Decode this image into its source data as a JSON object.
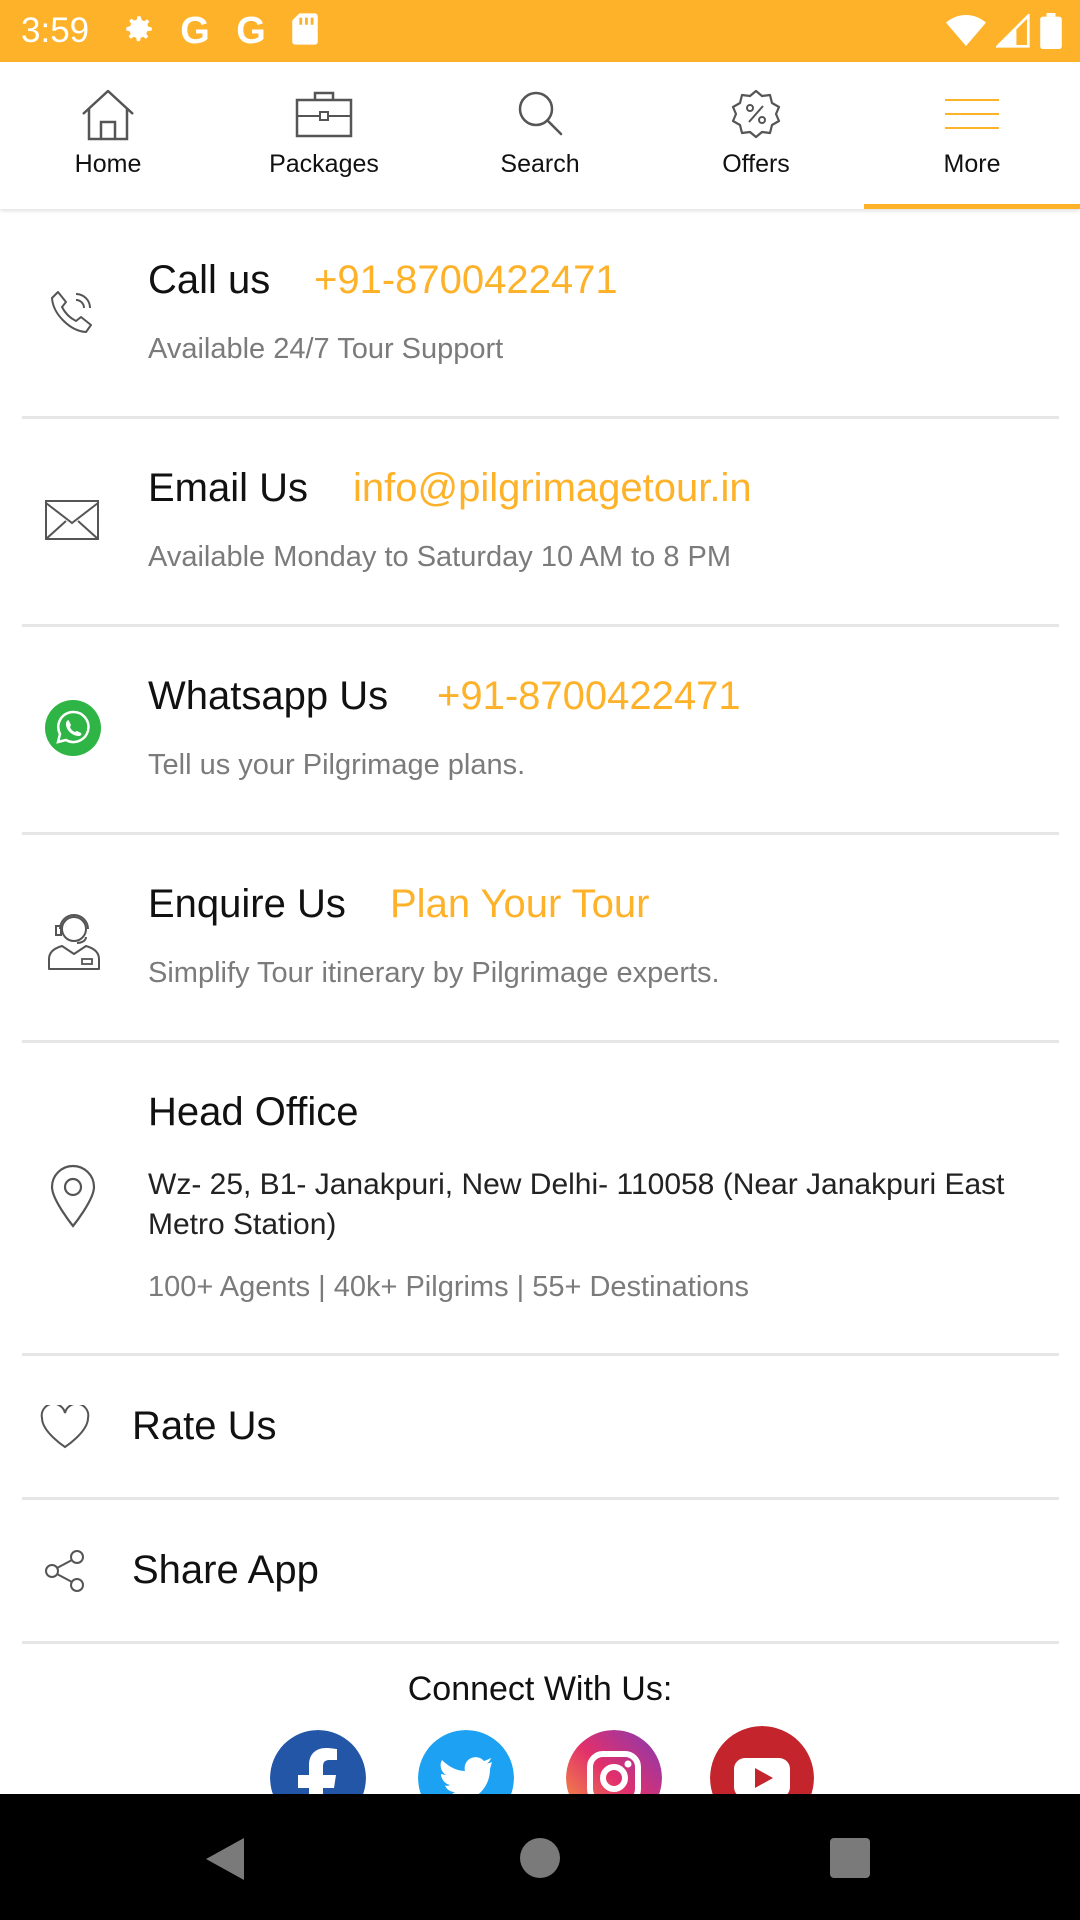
{
  "status_bar": {
    "time": "3:59",
    "color": "#FDB22A",
    "left_icons": [
      "gear-icon",
      "google-g-icon",
      "google-g-icon",
      "sd-card-icon"
    ],
    "right_icons": [
      "wifi-icon",
      "signal-icon",
      "battery-icon"
    ],
    "g_letter": "G"
  },
  "nav": {
    "tabs": [
      {
        "label": "Home",
        "icon": "home-icon"
      },
      {
        "label": "Packages",
        "icon": "briefcase-icon"
      },
      {
        "label": "Search",
        "icon": "search-icon"
      },
      {
        "label": "Offers",
        "icon": "offers-badge-icon"
      },
      {
        "label": "More",
        "icon": "menu-icon"
      }
    ],
    "active_tab": "More",
    "accent_color": "#FDB22A"
  },
  "items": {
    "call": {
      "title": "Call us",
      "value": "+91-8700422471",
      "subtitle": "Available 24/7 Tour Support",
      "icon": "phone-icon"
    },
    "email": {
      "title": "Email Us",
      "value": "info@pilgrimagetour.in",
      "subtitle": "Available Monday to Saturday 10 AM to 8 PM",
      "icon": "mail-icon"
    },
    "whatsapp": {
      "title": "Whatsapp Us",
      "value": "+91-8700422471",
      "subtitle": "Tell us your Pilgrimage plans.",
      "icon": "whatsapp-icon"
    },
    "enquire": {
      "title": "Enquire Us",
      "value": "Plan Your Tour",
      "subtitle": "Simplify Tour itinerary by Pilgrimage experts.",
      "icon": "support-agent-icon"
    },
    "office": {
      "title": "Head Office",
      "address": "Wz- 25, B1- Janakpuri, New Delhi- 110058 (Near Janakpuri East Metro Station)",
      "subtitle": "100+ Agents | 40k+ Pilgrims | 55+ Destinations",
      "icon": "location-pin-icon"
    },
    "rate": {
      "title": "Rate Us",
      "icon": "heart-icon"
    },
    "share": {
      "title": "Share App",
      "icon": "share-icon"
    }
  },
  "connect": {
    "label": "Connect With Us:",
    "social": [
      "facebook-icon",
      "twitter-icon",
      "instagram-icon",
      "youtube-icon"
    ]
  },
  "android_nav": [
    "back-icon",
    "home-circle-icon",
    "recents-icon"
  ]
}
